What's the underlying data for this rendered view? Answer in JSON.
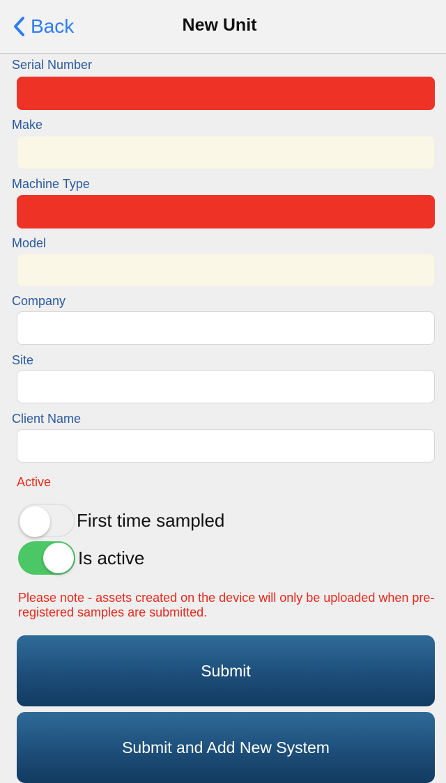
{
  "nav": {
    "back_label": "Back",
    "title": "New Unit"
  },
  "fields": [
    {
      "label": "Serial Number",
      "value": "",
      "state": "error"
    },
    {
      "label": "Make",
      "value": "",
      "state": "readonly"
    },
    {
      "label": "Machine Type",
      "value": "",
      "state": "error"
    },
    {
      "label": "Model",
      "value": "",
      "state": "readonly"
    },
    {
      "label": "Company",
      "value": "",
      "state": "normal"
    },
    {
      "label": "Site",
      "value": "",
      "state": "normal"
    },
    {
      "label": "Client Name",
      "value": "",
      "state": "normal"
    }
  ],
  "active_section": {
    "title": "Active",
    "toggles": [
      {
        "label": "First time sampled",
        "on": false
      },
      {
        "label": "Is active",
        "on": true
      }
    ]
  },
  "note": "Please note - assets created on the device will only be uploaded when pre-registered samples are submitted.",
  "buttons": {
    "submit_label": "Submit",
    "submit_add_label": "Submit and Add New System"
  },
  "colors": {
    "error_field": "#ee3326",
    "readonly_field": "#faf7e6",
    "label_blue": "#2b5aa0",
    "accent_red": "#e8281c",
    "toggle_on": "#4cc765",
    "button_blue": "#1d4e79",
    "link_blue": "#2f7df6"
  }
}
